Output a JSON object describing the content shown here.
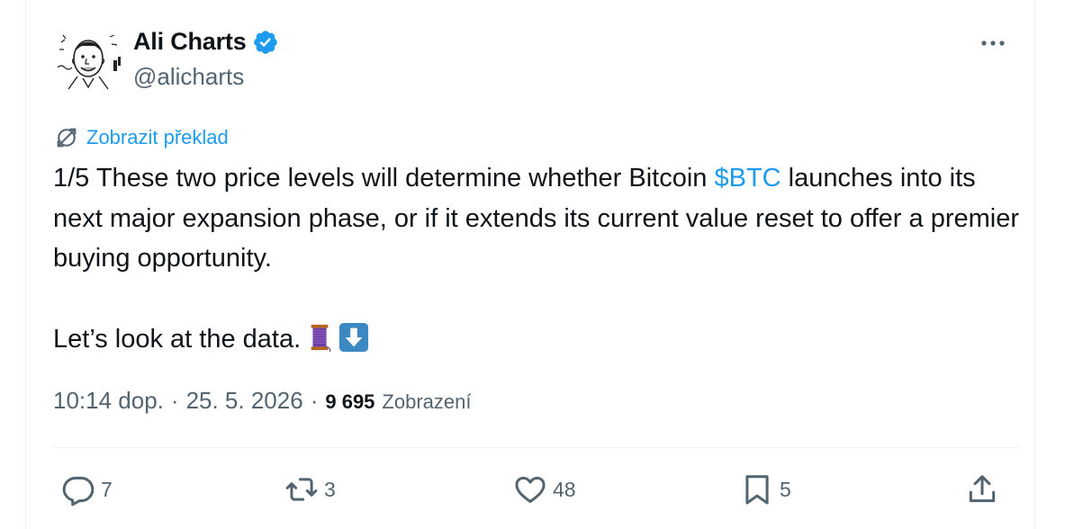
{
  "tweet": {
    "author_name": "Ali Charts",
    "author_handle": "@alicharts",
    "translate_label": "Zobrazit překlad",
    "text_line1_before": "1/5 These two price levels will determine whether Bitcoin ",
    "cashtag": "$BTC",
    "text_line1_after": " launches into its next major expansion phase, or if it extends its current value reset to offer a premier buying opportunity.",
    "text_line2": "Let’s look at the data.",
    "emojis": [
      "thread-spool-icon",
      "down-arrow-icon"
    ],
    "time": "10:14 dop.",
    "date": "25. 5. 2026",
    "views_count": "9 695",
    "views_label": "Zobrazení",
    "separator": "·"
  },
  "actions": {
    "replies": "7",
    "reposts": "3",
    "likes": "48",
    "bookmarks": "5"
  },
  "colors": {
    "accent": "#1d9bf0",
    "text": "#0f1419",
    "muted": "#536471",
    "border": "#eff3f4"
  }
}
